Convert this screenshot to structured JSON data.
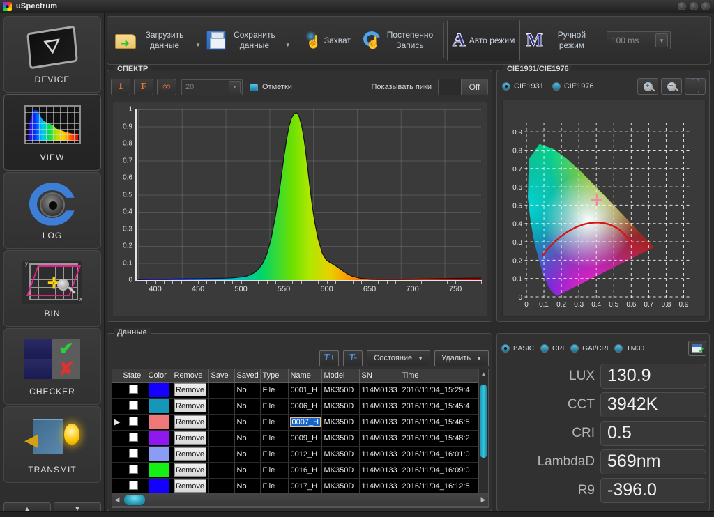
{
  "window": {
    "title": "uSpectrum",
    "controls": [
      "minimize",
      "maximize",
      "close"
    ]
  },
  "sidebar": {
    "items": [
      {
        "label": "DEVICE",
        "icon": "usb-icon",
        "selected": false
      },
      {
        "label": "VIEW",
        "icon": "spectrum-chart-icon",
        "selected": true
      },
      {
        "label": "LOG",
        "icon": "refresh-aperture-icon",
        "selected": false
      },
      {
        "label": "BIN",
        "icon": "bin-grid-icon",
        "selected": false
      },
      {
        "label": "CHECKER",
        "icon": "check-cross-icon",
        "selected": false
      },
      {
        "label": "TRANSMIT",
        "icon": "transmit-bulb-icon",
        "selected": false
      }
    ],
    "scroll_up": "▲",
    "scroll_down": "▼"
  },
  "toolbar": {
    "load_data": "Загрузить данные",
    "save_data": "Сохранить данные",
    "capture": "Захват",
    "gradual_record": "Постепенно Запись",
    "auto_mode": "Авто режим",
    "auto_letter": "A",
    "manual_mode": "Ручной режим",
    "manual_letter": "M",
    "exposure_value": "100 ms"
  },
  "spectrum": {
    "panel_title": "СПЕКТР",
    "btn_one": "1",
    "btn_f": "F",
    "btn_infinity": "∞",
    "count_value": "20",
    "marks_label": "Отметки",
    "show_peaks_label": "Показывать пики",
    "show_peaks_state": "Off"
  },
  "chart_data": {
    "type": "line",
    "title": "СПЕКТР",
    "xlabel": "",
    "ylabel": "",
    "xlim": [
      380,
      780
    ],
    "ylim": [
      0,
      1
    ],
    "grid": true,
    "x_ticks": [
      400,
      450,
      500,
      550,
      600,
      650,
      700,
      750
    ],
    "y_ticks": [
      "0",
      "0.1",
      "0.2",
      "0.3",
      "0.4",
      "0.5",
      "0.6",
      "0.7",
      "0.8",
      "0.9",
      "1"
    ],
    "peak_wavelength": 566,
    "peak_value": 0.98,
    "x": [
      380,
      390,
      400,
      410,
      420,
      430,
      440,
      450,
      460,
      470,
      480,
      490,
      500,
      505,
      510,
      515,
      520,
      525,
      530,
      535,
      540,
      545,
      550,
      553,
      556,
      559,
      562,
      565,
      566,
      568,
      571,
      574,
      577,
      580,
      583,
      586,
      590,
      595,
      600,
      605,
      610,
      615,
      620,
      625,
      630,
      640,
      650,
      660,
      680,
      700,
      720,
      740,
      760,
      780
    ],
    "y": [
      0.004,
      0.005,
      0.006,
      0.005,
      0.006,
      0.007,
      0.008,
      0.008,
      0.009,
      0.01,
      0.011,
      0.013,
      0.018,
      0.022,
      0.03,
      0.042,
      0.062,
      0.095,
      0.15,
      0.24,
      0.37,
      0.53,
      0.72,
      0.82,
      0.9,
      0.95,
      0.975,
      0.98,
      0.975,
      0.955,
      0.9,
      0.81,
      0.69,
      0.56,
      0.44,
      0.34,
      0.24,
      0.155,
      0.115,
      0.1,
      0.085,
      0.068,
      0.05,
      0.034,
      0.022,
      0.01,
      0.005,
      0.004,
      0.004,
      0.005,
      0.007,
      0.009,
      0.011,
      0.012
    ]
  },
  "cie": {
    "panel_title": "CIE1931/CIE1976",
    "option_1931": "CIE1931",
    "option_1976": "CIE1976",
    "selected": "CIE1931",
    "zoom_in_icon": "zoom-in-icon",
    "zoom_out_icon": "zoom-out-icon",
    "fit_icon": "fit-to-screen-icon",
    "x_ticks": [
      "0",
      "0.1",
      "0.2",
      "0.3",
      "0.4",
      "0.5",
      "0.6",
      "0.7",
      "0.8",
      "0.9"
    ],
    "y_ticks": [
      "0",
      "0.1",
      "0.2",
      "0.3",
      "0.4",
      "0.5",
      "0.6",
      "0.7",
      "0.8",
      "0.9"
    ],
    "marker_x": 0.403,
    "marker_y": 0.529,
    "marker_color": "#ef8ba0",
    "locus_color": "#d51616"
  },
  "data_panel": {
    "panel_title": "Данные",
    "add_text_btn": "T+",
    "remove_text_btn": "T-",
    "state_dropdown": "Состояние",
    "delete_dropdown": "Удалить",
    "columns": [
      "",
      "State",
      "Color",
      "Remove",
      "Save",
      "Saved",
      "Type",
      "Name",
      "Model",
      "SN",
      "Time"
    ],
    "remove_label": "Remove",
    "rows": [
      {
        "marker": "",
        "color": "#1400ff",
        "saved": "No",
        "type": "File",
        "name": "0001_H",
        "model": "MK350D",
        "sn": "114M0133",
        "time": "2016/11/04_15:29:4",
        "selected": false
      },
      {
        "marker": "",
        "color": "#1497b9",
        "saved": "No",
        "type": "File",
        "name": "0006_H",
        "model": "MK350D",
        "sn": "114M0133",
        "time": "2016/11/04_15:45:4",
        "selected": false
      },
      {
        "marker": "▶",
        "color": "#ef7878",
        "saved": "No",
        "type": "File",
        "name": "0007_H",
        "model": "MK350D",
        "sn": "114M0133",
        "time": "2016/11/04_15:46:5",
        "selected": true
      },
      {
        "marker": "",
        "color": "#9117f0",
        "saved": "No",
        "type": "File",
        "name": "0009_H",
        "model": "MK350D",
        "sn": "114M0133",
        "time": "2016/11/04_15:48:2",
        "selected": false
      },
      {
        "marker": "",
        "color": "#8b9cf5",
        "saved": "No",
        "type": "File",
        "name": "0012_H",
        "model": "MK350D",
        "sn": "114M0133",
        "time": "2016/11/04_16:01:0",
        "selected": false
      },
      {
        "marker": "",
        "color": "#14f014",
        "saved": "No",
        "type": "File",
        "name": "0016_H",
        "model": "MK350D",
        "sn": "114M0133",
        "time": "2016/11/04_16:09:0",
        "selected": false
      },
      {
        "marker": "",
        "color": "#1400ff",
        "saved": "No",
        "type": "File",
        "name": "0017_H",
        "model": "MK350D",
        "sn": "114M0133",
        "time": "2016/11/04_16:12:5",
        "selected": false
      }
    ]
  },
  "results": {
    "tabs": [
      {
        "label": "BASIC",
        "selected": true
      },
      {
        "label": "CRI",
        "selected": false
      },
      {
        "label": "GAI/CRI",
        "selected": false
      },
      {
        "label": "TM30",
        "selected": false
      }
    ],
    "export_icon": "export-sheet-icon",
    "measurements": [
      {
        "label": "LUX",
        "value": "130.9"
      },
      {
        "label": "CCT",
        "value": "3942K"
      },
      {
        "label": "CRI",
        "value": "0.5"
      },
      {
        "label": "LambdaD",
        "value": "569nm"
      },
      {
        "label": "R9",
        "value": "-396.0"
      }
    ]
  }
}
